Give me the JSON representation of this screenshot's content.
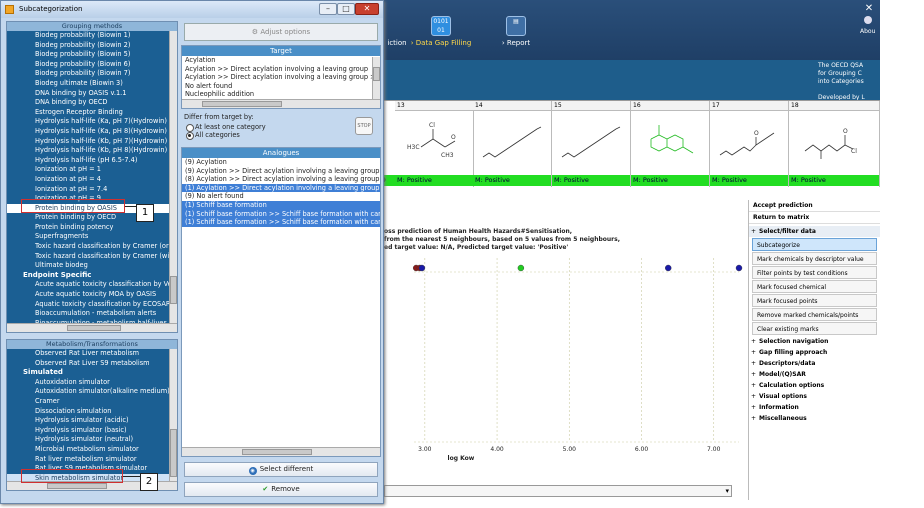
{
  "app": {
    "tabs": [
      {
        "label": "iction"
      },
      {
        "label": "Data Gap Filling",
        "icon_text": "0101\n01\n10100"
      },
      {
        "label": "Report"
      }
    ],
    "about_label": "Abou",
    "info_text": "The OECD QSA\nfor Grouping C\ninto Categories\n\nDeveloped by L",
    "columns": [
      {
        "num": "13",
        "result": "M: Positive",
        "structure": "acyl-chloride"
      },
      {
        "num": "14",
        "result": "M: Positive",
        "structure": "chain"
      },
      {
        "num": "15",
        "result": "M: Positive",
        "structure": "chain"
      },
      {
        "num": "16",
        "result": "M: Positive",
        "structure": "naphthalene"
      },
      {
        "num": "17",
        "result": "M: Positive",
        "structure": "chain-ester"
      },
      {
        "num": "18",
        "result": "M: Positive",
        "structure": "acyl-chloride-2"
      }
    ],
    "left_cut_text": "/9",
    "mol_labels": {
      "cl": "Cl",
      "o": "O",
      "h3c": "H3C",
      "ch3": "CH3"
    },
    "right_panel": {
      "accept_prediction": "Accept prediction",
      "return_to_matrix": "Return to matrix",
      "select_filter_header": "Select/filter data",
      "buttons": [
        "Subcategorize",
        "Mark chemicals by descriptor value",
        "Filter points by test conditions",
        "Mark focused chemical",
        "Mark focused points",
        "Remove marked chemicals/points",
        "Clear existing marks"
      ],
      "sections": [
        "Selection navigation",
        "Gap filling approach",
        "Descriptors/data",
        "Model/(Q)SAR",
        "Calculation options",
        "Visual options",
        "Information",
        "Miscellaneous"
      ]
    },
    "prediction_text": [
      "oss prediction of Human Health Hazards#Sensitisation,",
      "from the nearest 5 neighbours, based on 5 values from 5 neighbours,",
      "ed target value: N/A, Predicted target value: 'Positive'"
    ]
  },
  "chart_data": {
    "type": "scatter",
    "xlabel": "log Kow",
    "xticks": [
      "3.00",
      "4.00",
      "5.00",
      "6.00",
      "7.00"
    ],
    "xlim": [
      2.85,
      7.35
    ],
    "points": [
      {
        "x": 2.88,
        "color": "#8b1a1a"
      },
      {
        "x": 2.93,
        "color": "#8b1a1a"
      },
      {
        "x": 2.96,
        "color": "#1a1aa8"
      },
      {
        "x": 4.33,
        "color": "#22cc22"
      },
      {
        "x": 6.37,
        "color": "#1a1aa8"
      },
      {
        "x": 7.38,
        "color": "#1a1aa8"
      }
    ]
  },
  "dialog": {
    "title": "Subcategorization",
    "adjust_options": "Adjust options",
    "grouping_header": "Grouping methods",
    "grouping_items": [
      {
        "label": "Biodeg probability (Biowin 1)"
      },
      {
        "label": "Biodeg probability (Biowin 2)"
      },
      {
        "label": "Biodeg probability (Biowin 5)"
      },
      {
        "label": "Biodeg probability (Biowin 6)"
      },
      {
        "label": "Biodeg probability (Biowin 7)"
      },
      {
        "label": "Biodeg ultimate (Biowin 3)"
      },
      {
        "label": "DNA binding by OASIS v.1.1"
      },
      {
        "label": "DNA binding by OECD"
      },
      {
        "label": "Estrogen Receptor Binding"
      },
      {
        "label": "Hydrolysis half-life (Ka, pH 7)(Hydrowin)"
      },
      {
        "label": "Hydrolysis half-life (Ka, pH 8)(Hydrowin)"
      },
      {
        "label": "Hydrolysis half-life (Kb, pH 7)(Hydrowin)"
      },
      {
        "label": "Hydrolysis half-life (Kb, pH 8)(Hydrowin)"
      },
      {
        "label": "Hydrolysis half-life (pH 6.5-7.4)"
      },
      {
        "label": "Ionization at pH = 1"
      },
      {
        "label": "Ionization at pH = 4"
      },
      {
        "label": "Ionization at pH = 7.4"
      },
      {
        "label": "Ionization at pH = 9"
      },
      {
        "label": "Protein binding by OASIS",
        "highlight": true
      },
      {
        "label": "Protein binding by OECD"
      },
      {
        "label": "Protein binding potency"
      },
      {
        "label": "Superfragments"
      },
      {
        "label": "Toxic hazard classification by Cramer (orig"
      },
      {
        "label": "Toxic hazard classification by Cramer (wit"
      },
      {
        "label": "Ultimate biodeg"
      },
      {
        "label": "Endpoint Specific",
        "category": true
      },
      {
        "label": "Acute aquatic toxicity classification by Ve"
      },
      {
        "label": "Acute aquatic toxicity MOA by OASIS"
      },
      {
        "label": "Aquatic toxicity classification by ECOSAR"
      },
      {
        "label": "Bioaccumulation - metabolism alerts"
      },
      {
        "label": "Bioaccumulation - metabolism half-lives"
      }
    ],
    "metabolism_header": "Metabolism/Transformations",
    "metabolism_items": [
      {
        "label": "Observed Rat Liver metabolism"
      },
      {
        "label": "Observed Rat Liver S9  metabolism"
      },
      {
        "label": "Simulated",
        "category": true
      },
      {
        "label": "Autoxidation simulator"
      },
      {
        "label": "Autoxidation simulator(alkaline medium)"
      },
      {
        "label": "Cramer"
      },
      {
        "label": "Dissociation simulation"
      },
      {
        "label": "Hydrolysis simulator (acidic)"
      },
      {
        "label": "Hydrolysis simulator (basic)"
      },
      {
        "label": "Hydrolysis simulator (neutral)"
      },
      {
        "label": "Microbial metabolism simulator"
      },
      {
        "label": "Rat liver metabolism simulator"
      },
      {
        "label": "Rat liver S9 metabolism simulator"
      },
      {
        "label": "Skin metabolism simulator",
        "selected": true
      }
    ],
    "callout_1": "1",
    "callout_2": "2",
    "target_header": "Target",
    "target_lines": [
      "Acylation",
      "Acylation >> Direct acylation involving a leaving group",
      "Acylation >> Direct acylation involving a leaving group >",
      "No alert found",
      "Nucleophilic addition"
    ],
    "differ_label": "Differ from target by:",
    "radio_at_least": "At least one category",
    "radio_all": "All categories",
    "stop_icon_text": "STOP",
    "analogues_header": "Analogues",
    "analogue_lines": [
      {
        "text": "(9) Acylation"
      },
      {
        "text": "(9) Acylation >> Direct acylation involving a leaving group"
      },
      {
        "text": "(8) Acylation >> Direct acylation involving a leaving group >"
      },
      {
        "text": "(1) Acylation >> Direct acylation involving a leaving group",
        "selected": true
      },
      {
        "text": "(9) No alert found"
      },
      {
        "text": "(1) Schiff base formation",
        "selected": true
      },
      {
        "text": "(1) Schiff base formation >> Schiff base formation with car",
        "selected": true
      },
      {
        "text": "(1) Schiff base formation >> Schiff base formation with car",
        "selected": true
      }
    ],
    "select_different": "Select different",
    "remove": "Remove"
  }
}
